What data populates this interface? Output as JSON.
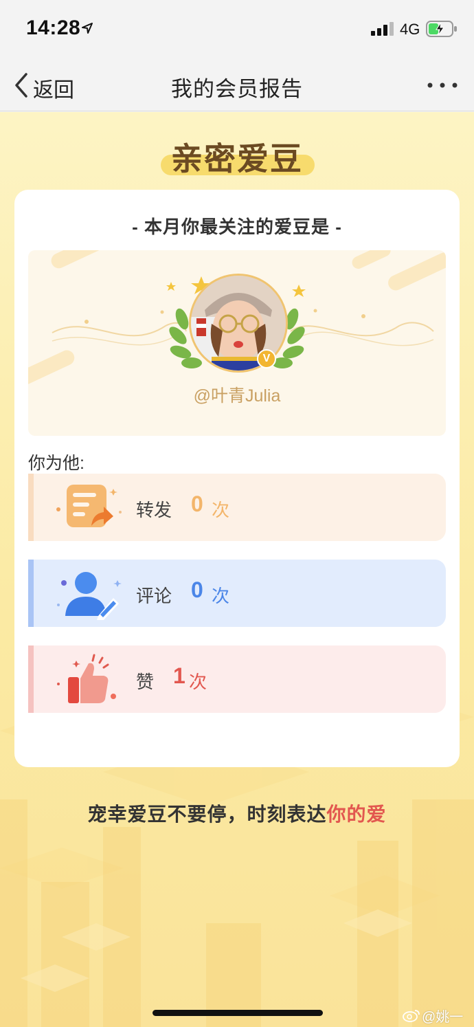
{
  "status_bar": {
    "time": "14:28",
    "network": "4G"
  },
  "nav": {
    "back_label": "返回",
    "title": "我的会员报告"
  },
  "section": {
    "title": "亲密爱豆"
  },
  "card": {
    "subtitle": "- 本月你最关注的爱豆是 -",
    "idol_name": "@叶青Julia",
    "verified_mark": "V",
    "for_him": "你为他:"
  },
  "stats": [
    {
      "label": "转发",
      "count": "0",
      "unit": "次"
    },
    {
      "label": "评论",
      "count": "0",
      "unit": "次"
    },
    {
      "label": "赞",
      "count": "1",
      "unit": "次"
    }
  ],
  "slogan": {
    "main": "宠幸爱豆不要停，时刻表达",
    "highlight": "你的爱"
  },
  "watermark": "@姚一奇",
  "colors": {
    "background_yellow": "#fdf4c4",
    "title_brown": "#6b4a22",
    "forward_accent": "#f3b56a",
    "comment_accent": "#4b86e8",
    "like_accent": "#e2574f"
  }
}
